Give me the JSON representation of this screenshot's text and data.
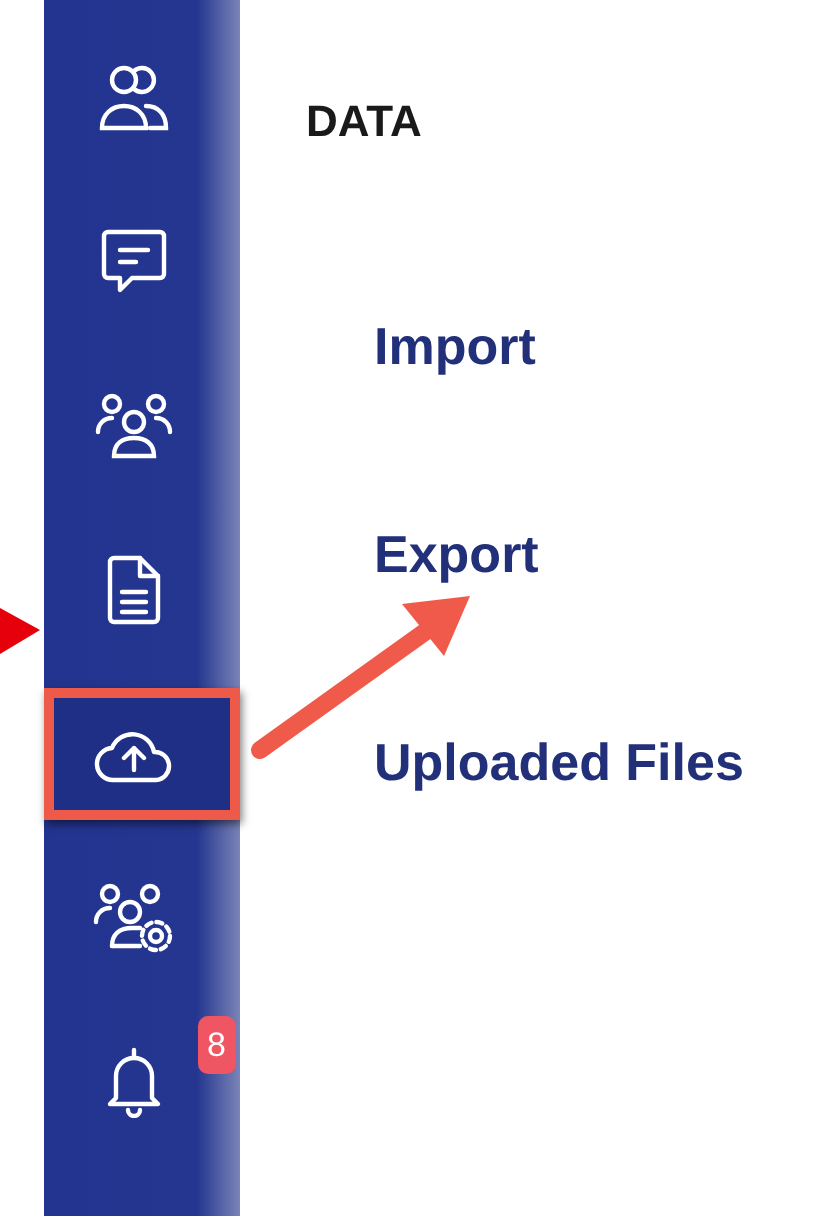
{
  "sidebar": {
    "items": [
      {
        "highlighted": false
      },
      {
        "highlighted": false
      },
      {
        "highlighted": false
      },
      {
        "highlighted": false
      },
      {
        "highlighted": true
      },
      {
        "highlighted": false
      },
      {
        "highlighted": false,
        "badge": "8"
      }
    ]
  },
  "content": {
    "heading": "DATA",
    "links": [
      "Import",
      "Export",
      "Uploaded Files"
    ]
  }
}
